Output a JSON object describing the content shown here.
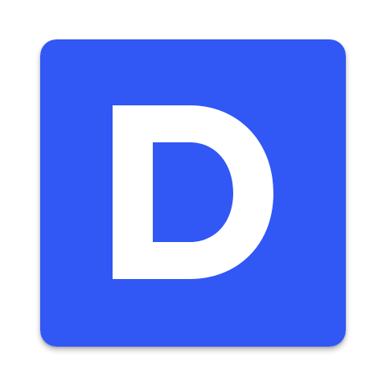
{
  "app_icon": {
    "icon_name": "letter-d-logo-icon",
    "letter": "D",
    "background_color": "#3157F5",
    "letter_color": "#FFFFFF"
  }
}
